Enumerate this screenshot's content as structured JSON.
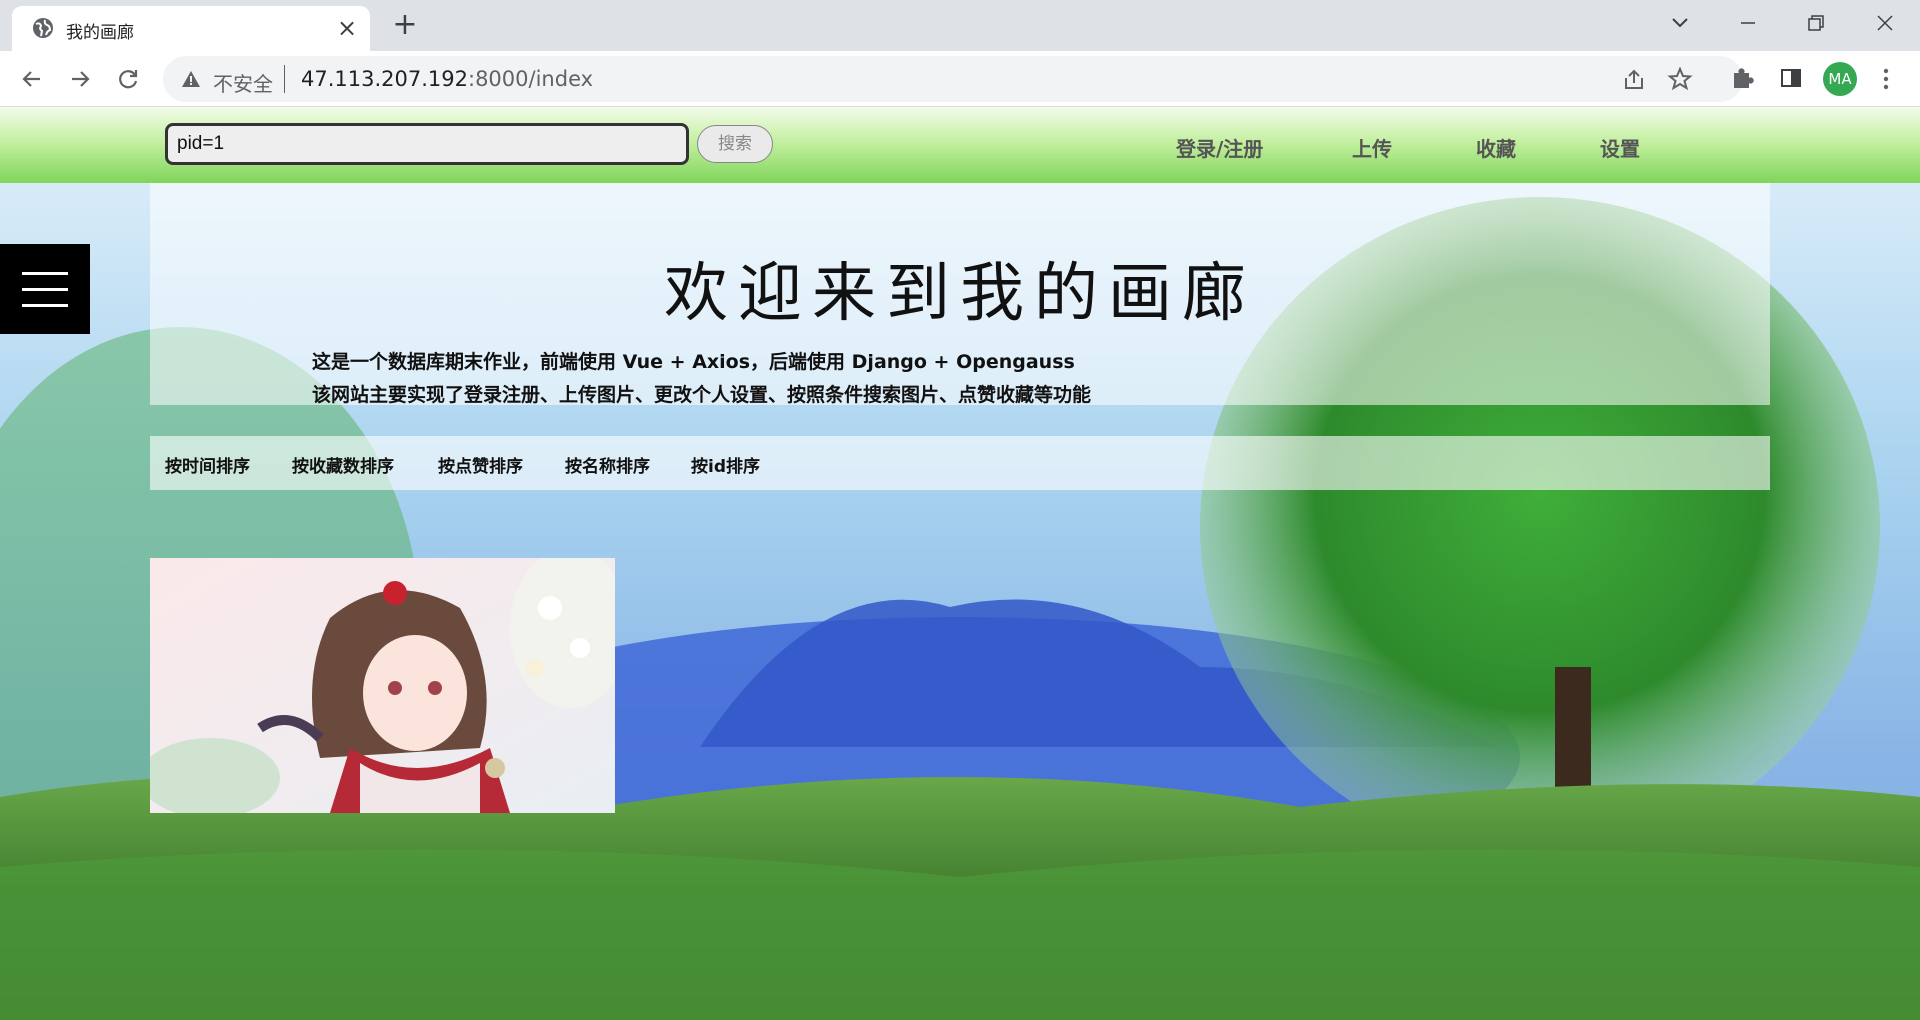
{
  "browser": {
    "tab_title": "我的画廊",
    "new_tab": "+",
    "tab_close": "×",
    "security_label": "不安全",
    "url_host": "47.113.207.192",
    "url_path": ":8000/index",
    "profile_initials": "MA"
  },
  "header": {
    "search_value": "pid=1",
    "search_button": "搜索",
    "nav": [
      "登录/注册",
      "上传",
      "收藏",
      "设置"
    ]
  },
  "hero": {
    "title": "欢迎来到我的画廊",
    "desc_line1": "这是一个数据库期末作业，前端使用 Vue + Axios，后端使用 Django + Opengauss",
    "desc_line2": "该网站主要实现了登录注册、上传图片、更改个人设置、按照条件搜索图片、点赞收藏等功能"
  },
  "sort_options": [
    "按时间排序",
    "按收藏数排序",
    "按点赞排序",
    "按名称排序",
    "按id排序"
  ],
  "colors": {
    "header_green": "#7fd55a",
    "avatar_green": "#34a853"
  },
  "icons": {
    "tab": "globe-icon",
    "nav": [
      "back-arrow-icon",
      "forward-arrow-icon",
      "reload-icon"
    ],
    "omnibox": [
      "warning-icon",
      "share-icon",
      "star-icon"
    ],
    "toolbar": [
      "puzzle-icon",
      "side-panel-icon",
      "kebab-menu-icon"
    ],
    "window": [
      "minimize-icon",
      "restore-icon",
      "close-icon"
    ],
    "page": [
      "hamburger-menu-icon"
    ]
  }
}
